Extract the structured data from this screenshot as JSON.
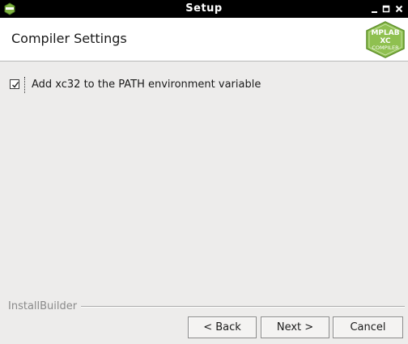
{
  "window": {
    "title": "Setup",
    "controls": [
      "minimize-icon",
      "maximize-icon",
      "close-icon"
    ]
  },
  "header": {
    "page_title": "Compiler Settings",
    "logo": {
      "line1": "MPLAB",
      "line2": "XC",
      "line3": "COMPILER"
    }
  },
  "options": [
    {
      "label": "Add xc32 to the PATH environment variable",
      "checked": true
    }
  ],
  "footer": {
    "brand": "InstallBuilder",
    "back_label": "< Back",
    "next_label": "Next >",
    "cancel_label": "Cancel"
  },
  "colors": {
    "titlebar": "#000000",
    "background": "#edeceb",
    "logo_green": "#7fb340"
  }
}
